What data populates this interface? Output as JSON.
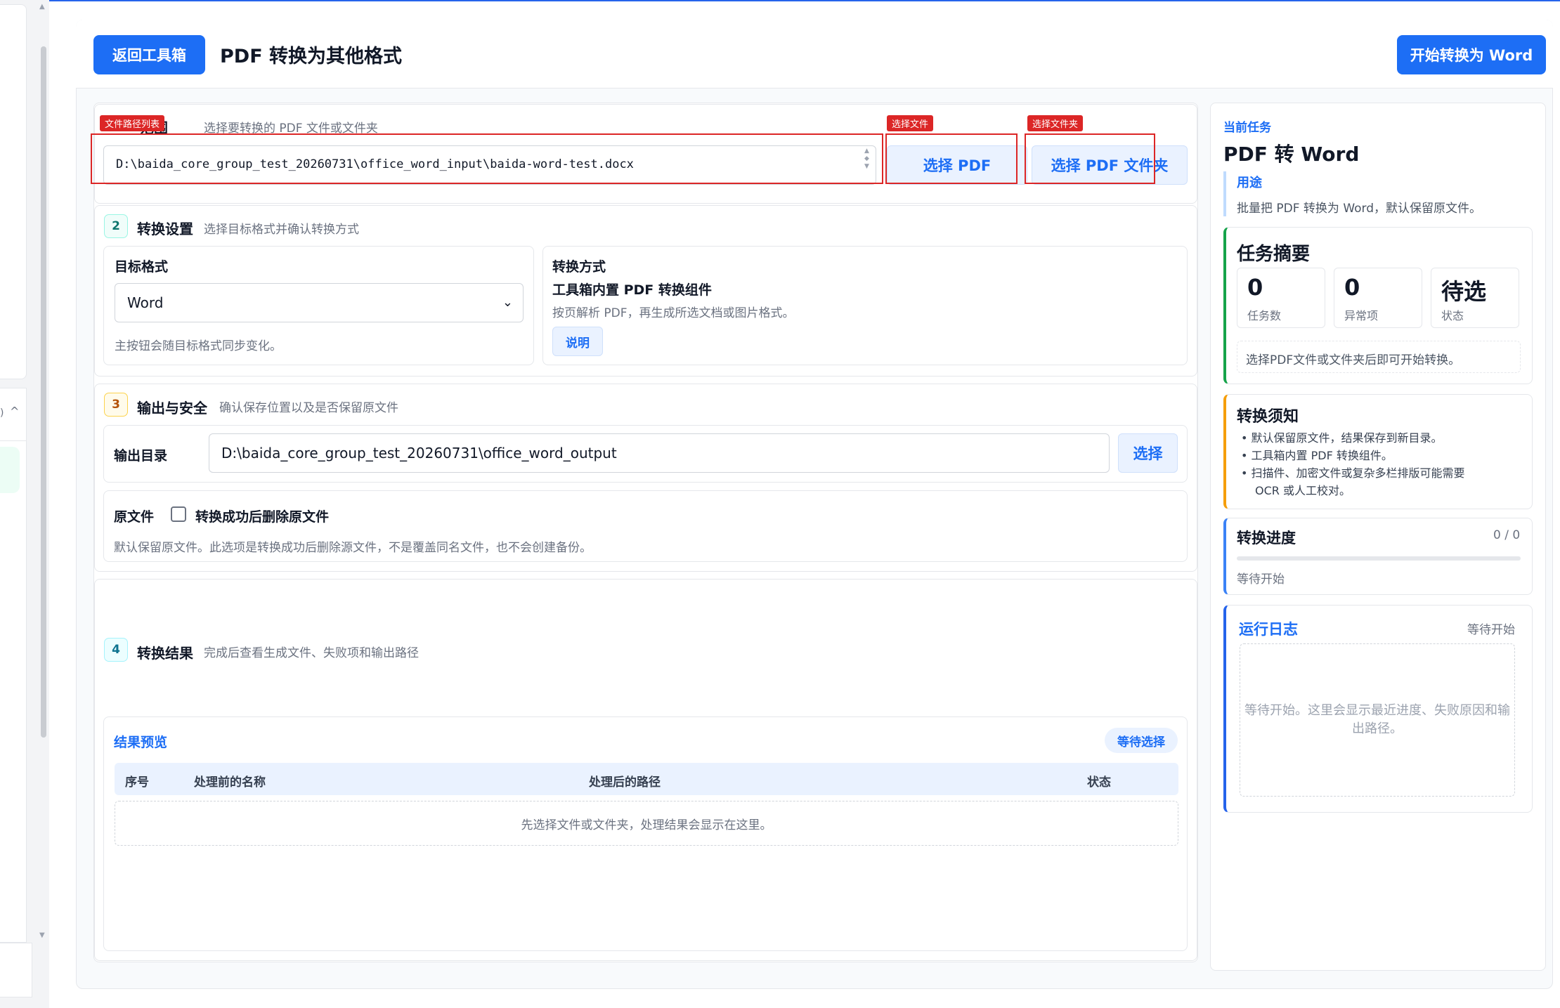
{
  "header": {
    "back_label": "返回工具箱",
    "title": "PDF 转换为其他格式",
    "start_label": "开始转换为 Word"
  },
  "step1": {
    "title": "范围",
    "subtitle": "选择要转换的 PDF 文件或文件夹",
    "path_value": "D:\\baida_core_group_test_20260731\\office_word_input\\baida-word-test.docx",
    "select_pdf_label": "选择 PDF",
    "select_folder_label": "选择 PDF 文件夹",
    "tag_paths": "文件路径列表",
    "tag_file": "选择文件",
    "tag_folder": "选择文件夹"
  },
  "step2": {
    "number": "2",
    "title": "转换设置",
    "subtitle": "选择目标格式并确认转换方式",
    "target_label": "目标格式",
    "target_value": "Word",
    "target_hint": "主按钮会随目标格式同步变化。",
    "method_label": "转换方式",
    "method_name": "工具箱内置 PDF 转换组件",
    "method_desc": "按页解析 PDF，再生成所选文档或图片格式。",
    "explain_label": "说明"
  },
  "step3": {
    "number": "3",
    "title": "输出与安全",
    "subtitle": "确认保存位置以及是否保留原文件",
    "out_label": "输出目录",
    "out_value": "D:\\baida_core_group_test_20260731\\office_word_output",
    "out_btn": "选择",
    "orig_label": "原文件",
    "delete_label": "转换成功后删除原文件",
    "delete_hint": "默认保留原文件。此选项是转换成功后删除源文件，不是覆盖同名文件，也不会创建备份。"
  },
  "step4": {
    "number": "4",
    "title": "转换结果",
    "subtitle": "完成后查看生成文件、失败项和输出路径",
    "preview_label": "结果预览",
    "badge": "等待选择",
    "columns": [
      "序号",
      "处理前的名称",
      "处理后的路径",
      "状态"
    ],
    "empty_text": "先选择文件或文件夹，处理结果会显示在这里。"
  },
  "sidebar": {
    "current_task_label": "当前任务",
    "task_name": "PDF 转 Word",
    "purpose_label": "用途",
    "purpose_text": "批量把 PDF 转换为 Word，默认保留原文件。",
    "summary_title": "任务摘要",
    "stats": [
      {
        "value": "0",
        "label": "任务数"
      },
      {
        "value": "0",
        "label": "异常项"
      },
      {
        "value": "待选",
        "label": "状态"
      }
    ],
    "summary_hint": "选择PDF文件或文件夹后即可开始转换。",
    "notice_title": "转换须知",
    "notices": [
      "默认保留原文件，结果保存到新目录。",
      "工具箱内置 PDF 转换组件。",
      "扫描件、加密文件或复杂多栏排版可能需要",
      "OCR 或人工校对。"
    ],
    "progress_title": "转换进度",
    "progress_count": "0 / 0",
    "progress_fraction": 0,
    "progress_status": "等待开始",
    "log_title": "运行日志",
    "log_status": "等待开始",
    "log_text": "等待开始。这里会显示最近进度、失败原因和输出路径。"
  },
  "colors": {
    "accent": "#1d6ef5",
    "annotation": "#dc2626",
    "summary_bar": "#16a34a",
    "notice_bar": "#f59e0b",
    "log_bar": "#2563eb"
  }
}
